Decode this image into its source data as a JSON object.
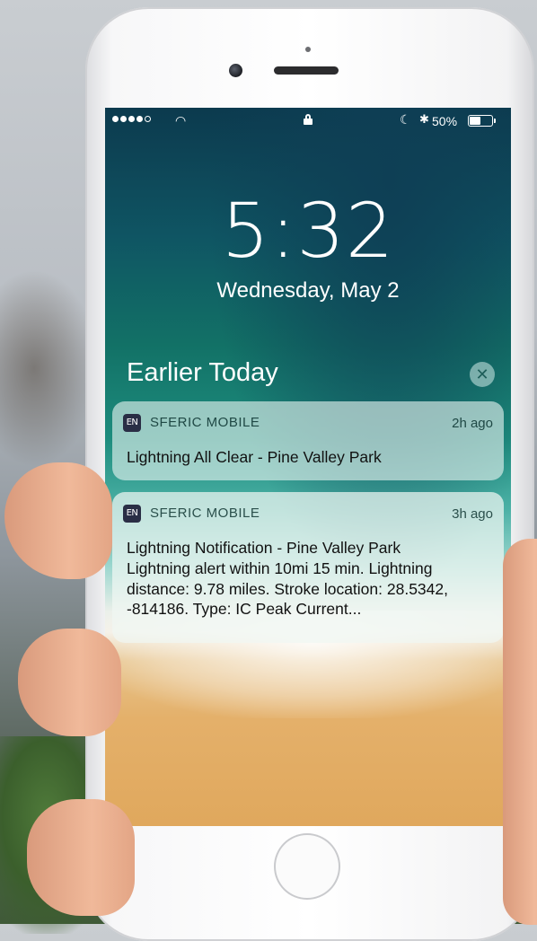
{
  "status_bar": {
    "signal_bars_filled": 4,
    "signal_bars_total": 5,
    "wifi_icon": "wifi-icon",
    "lock_icon": "lock-icon",
    "moon_icon": "moon-icon",
    "bluetooth_icon": "bluetooth-icon",
    "battery_percent": "50%",
    "battery_level": 0.5
  },
  "lock_screen": {
    "time": "5:32",
    "date": "Wednesday, May 2",
    "section_title": "Earlier Today",
    "clear_icon": "✕"
  },
  "notifications": [
    {
      "app_icon_text": "EN",
      "app_name": "SFERIC MOBILE",
      "time": "2h ago",
      "title": "Lightning All Clear - Pine Valley Park",
      "body": ""
    },
    {
      "app_icon_text": "EN",
      "app_name": "SFERIC MOBILE",
      "time": "3h ago",
      "title": "Lightning Notification - Pine Valley Park",
      "body": "Lightning alert within 10mi 15 min. Lightning distance: 9.78 miles. Stroke location: 28.5342, -814186. Type: IC Peak Current..."
    }
  ],
  "colors": {
    "app_icon_bg": "#2a2e45",
    "screen_top": "#0c3a4e",
    "sand": "#e0a85d"
  }
}
